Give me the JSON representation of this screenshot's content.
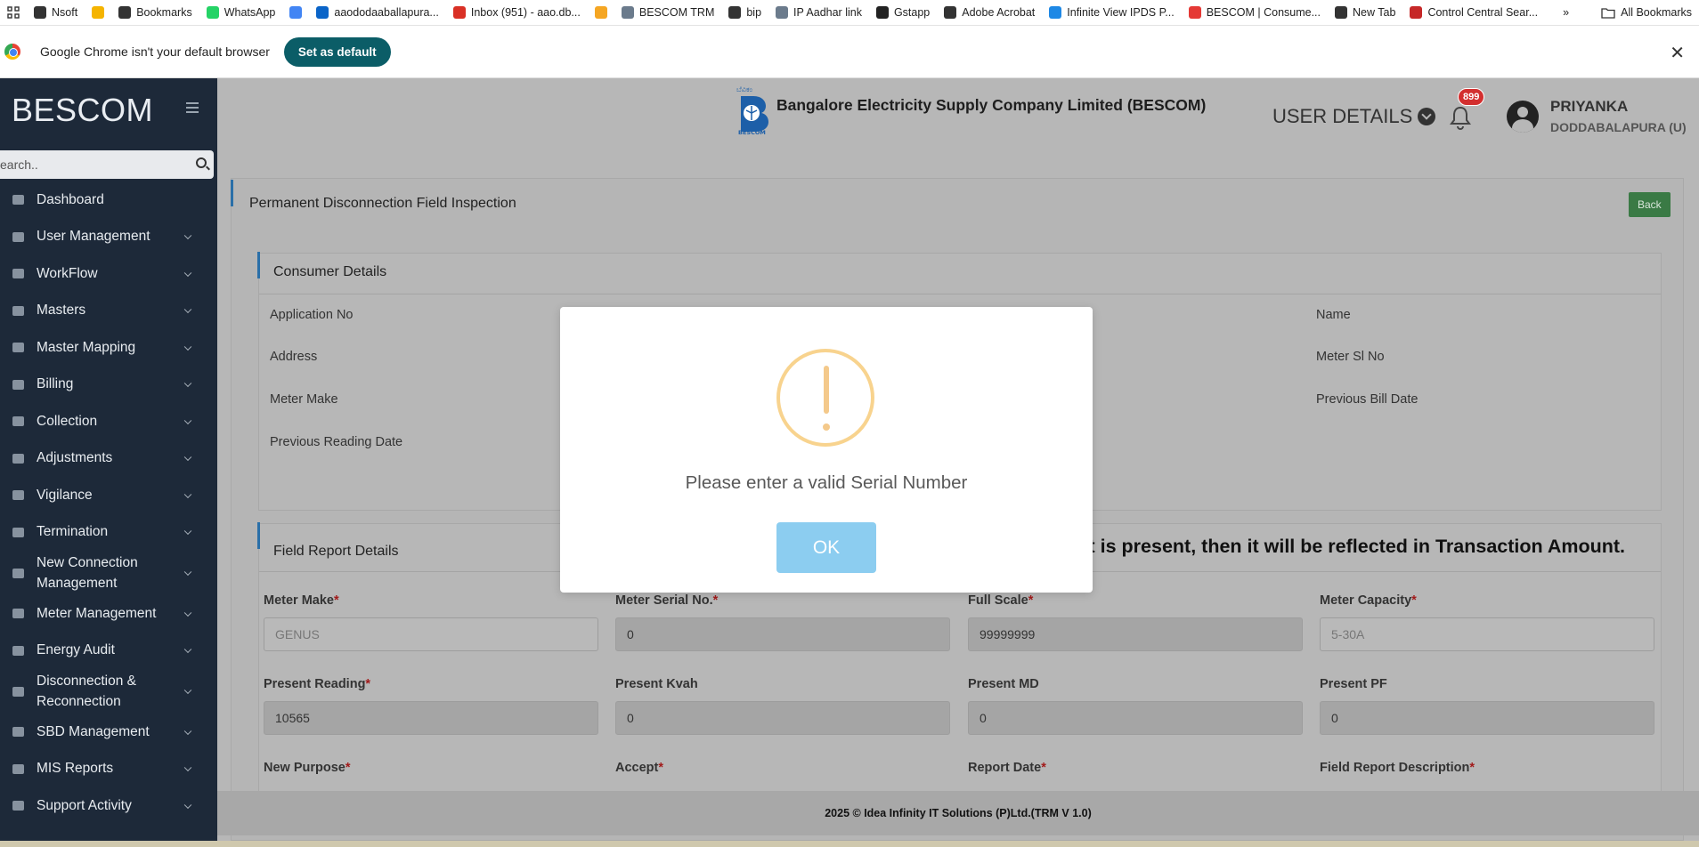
{
  "bookmarks": {
    "items": [
      {
        "label": "Nsoft",
        "icon": "globe-icon",
        "color": "#333333"
      },
      {
        "label": "",
        "icon": "emoji-icon",
        "color": "#f5b400"
      },
      {
        "label": "Bookmarks",
        "icon": "star-icon",
        "color": "#333333"
      },
      {
        "label": "WhatsApp",
        "icon": "whatsapp-icon",
        "color": "#25d366"
      },
      {
        "label": "",
        "icon": "google-icon",
        "color": "#4285f4"
      },
      {
        "label": "aaododaaballapura...",
        "icon": "outlook-icon",
        "color": "#0a64c8"
      },
      {
        "label": "Inbox (951) - aao.db...",
        "icon": "gmail-icon",
        "color": "#d93025"
      },
      {
        "label": "",
        "icon": "amazon-icon",
        "color": "#f5a623"
      },
      {
        "label": "BESCOM TRM",
        "icon": "doc-icon",
        "color": "#6b7b8c"
      },
      {
        "label": "bip",
        "icon": "globe-icon",
        "color": "#333333"
      },
      {
        "label": "IP Aadhar link",
        "icon": "doc-icon",
        "color": "#6b7b8c"
      },
      {
        "label": "Gstapp",
        "icon": "angular-icon",
        "color": "#222222"
      },
      {
        "label": "Adobe Acrobat",
        "icon": "globe-icon",
        "color": "#333333"
      },
      {
        "label": "Infinite View IPDS P...",
        "icon": "infinite-icon",
        "color": "#1e88e5"
      },
      {
        "label": "BESCOM | Consume...",
        "icon": "bescom-icon",
        "color": "#e53935"
      },
      {
        "label": "New Tab",
        "icon": "globe-icon",
        "color": "#333333"
      },
      {
        "label": "Control Central Sear...",
        "icon": "oracle-icon",
        "color": "#c62828"
      }
    ],
    "more_label": "»",
    "all_bookmarks_label": "All Bookmarks"
  },
  "infobar": {
    "message": "Google Chrome isn't your default browser",
    "button_label": "Set as default",
    "close_label": "✕"
  },
  "sidebar": {
    "brand": "BESCOM",
    "search_placeholder": "earch..",
    "items": [
      {
        "label": "Dashboard",
        "icon": "dashboard-icon",
        "has_chevron": false
      },
      {
        "label": "User Management",
        "icon": "user-icon",
        "has_chevron": true
      },
      {
        "label": "WorkFlow",
        "icon": "user-icon",
        "has_chevron": true
      },
      {
        "label": "Masters",
        "icon": "list-icon",
        "has_chevron": true
      },
      {
        "label": "Master Mapping",
        "icon": "sitemap-icon",
        "has_chevron": true
      },
      {
        "label": "Billing",
        "icon": "monitor-icon",
        "has_chevron": true
      },
      {
        "label": "Collection",
        "icon": "list-icon",
        "has_chevron": true
      },
      {
        "label": "Adjustments",
        "icon": "scale-icon",
        "has_chevron": true
      },
      {
        "label": "Vigilance",
        "icon": "vk-icon",
        "has_chevron": true
      },
      {
        "label": "Termination",
        "icon": "trash-icon",
        "has_chevron": true
      },
      {
        "label": "New Connection Management",
        "icon": "plus-circle-icon",
        "has_chevron": true
      },
      {
        "label": "Meter Management",
        "icon": "list-icon",
        "has_chevron": true
      },
      {
        "label": "Energy Audit",
        "icon": "gears-icon",
        "has_chevron": true
      },
      {
        "label": "Disconnection & Reconnection",
        "icon": "link-icon",
        "has_chevron": true
      },
      {
        "label": "SBD Management",
        "icon": "mobile-icon",
        "has_chevron": true
      },
      {
        "label": "MIS Reports",
        "icon": "bar-chart-icon",
        "has_chevron": true
      },
      {
        "label": "Support Activity",
        "icon": "headset-icon",
        "has_chevron": true
      }
    ]
  },
  "header": {
    "company": "Bangalore Electricity Supply Company Limited (BESCOM)",
    "user_details_label": "USER DETAILS",
    "notification_count": "899",
    "user_name": "PRIYANKA",
    "user_location": "DODDABALAPURA (U)"
  },
  "page": {
    "title": "Permanent Disconnection Field Inspection",
    "back_label": "Back"
  },
  "consumer_details": {
    "title": "Consumer Details",
    "labels": {
      "application_no": "Application No",
      "name": "Name",
      "address": "Address",
      "meter_sl_no": "Meter Sl No",
      "meter_make": "Meter Make",
      "previous_bill_date": "Previous Bill Date",
      "previous_reading_date": "Previous Reading Date"
    }
  },
  "field_report": {
    "title": "Field Report Details",
    "notice": "mount is present, then it will be reflected in Transaction Amount.",
    "fields": {
      "meter_make": {
        "label": "Meter Make",
        "value": "GENUS"
      },
      "meter_serial": {
        "label": "Meter Serial No.",
        "value": "0"
      },
      "full_scale": {
        "label": "Full Scale",
        "value": "99999999"
      },
      "meter_capacity": {
        "label": "Meter Capacity",
        "value": "5-30A"
      },
      "present_reading": {
        "label": "Present Reading",
        "value": "10565"
      },
      "present_kvah": {
        "label": "Present Kvah",
        "value": "0"
      },
      "present_md": {
        "label": "Present MD",
        "value": "0"
      },
      "present_pf": {
        "label": "Present PF",
        "value": "0"
      },
      "new_purpose": {
        "label": "New Purpose"
      },
      "accept": {
        "label": "Accept"
      },
      "report_date": {
        "label": "Report Date"
      },
      "field_report_description": {
        "label": "Field Report Description"
      }
    },
    "required_mark": "*"
  },
  "footer": {
    "text": "2025 © Idea Infinity IT Solutions (P)Ltd.(TRM V 1.0)"
  },
  "modal": {
    "icon": "warning-icon",
    "message": "Please enter a valid Serial Number",
    "ok_label": "OK"
  }
}
